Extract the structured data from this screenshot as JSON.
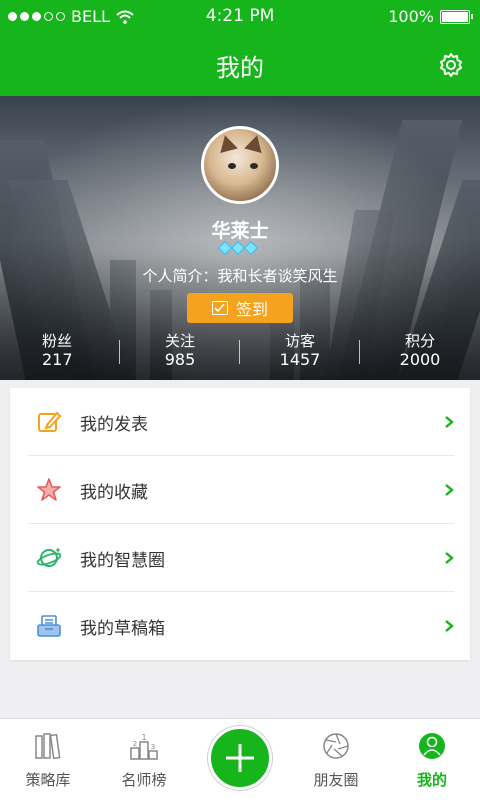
{
  "status_bar": {
    "carrier": "BELL",
    "time": "4:21 PM",
    "battery": "100%"
  },
  "nav": {
    "title": "我的",
    "settings_icon": "gear-icon"
  },
  "profile": {
    "username": "华莱士",
    "bio": "个人简介：我和长者谈笑风生",
    "checkin_label": "签到"
  },
  "stats": [
    {
      "label": "粉丝",
      "value": "217"
    },
    {
      "label": "关注",
      "value": "985"
    },
    {
      "label": "访客",
      "value": "1457"
    },
    {
      "label": "积分",
      "value": "2000"
    }
  ],
  "menu": [
    {
      "label": "我的发表",
      "icon": "pencil-icon"
    },
    {
      "label": "我的收藏",
      "icon": "star-icon"
    },
    {
      "label": "我的智慧圈",
      "icon": "planet-icon"
    },
    {
      "label": "我的草稿箱",
      "icon": "inbox-icon"
    }
  ],
  "tabs": [
    {
      "label": "策略库",
      "icon": "books-icon"
    },
    {
      "label": "名师榜",
      "icon": "podium-icon"
    },
    {
      "label": "朋友圈",
      "icon": "aperture-icon"
    },
    {
      "label": "我的",
      "icon": "user-icon"
    }
  ],
  "colors": {
    "primary": "#16b51b",
    "checkin": "#f5a21f",
    "pencil": "#f5a21f",
    "star": "#e85a5a",
    "planet": "#2fb36b",
    "inbox": "#4a8fd9"
  }
}
